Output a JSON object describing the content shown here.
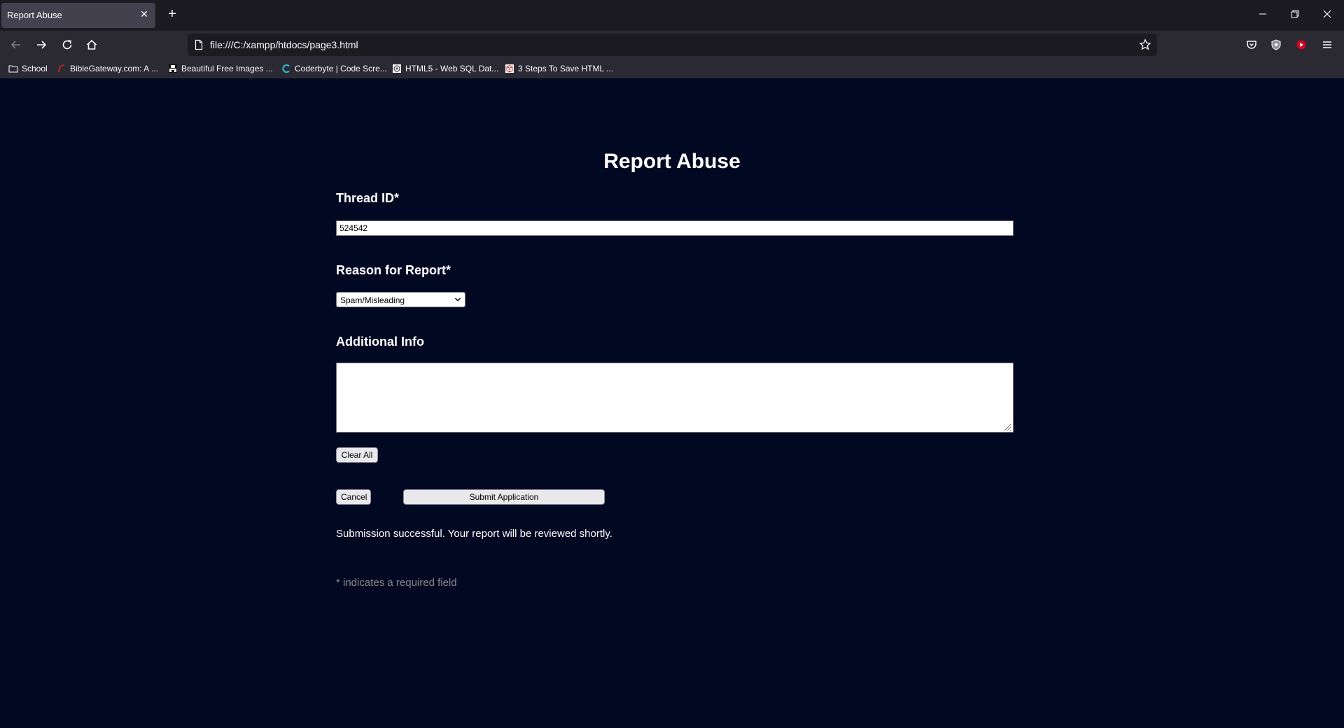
{
  "browser": {
    "tab_title": "Report Abuse",
    "url": "file:///C:/xampp/htdocs/page3.html",
    "bookmarks": [
      {
        "label": "School",
        "icon": "folder-icon"
      },
      {
        "label": "BibleGateway.com: A ...",
        "icon": "biblegateway-icon"
      },
      {
        "label": "Beautiful Free Images ...",
        "icon": "unsplash-icon"
      },
      {
        "label": "Coderbyte | Code Scre...",
        "icon": "coderbyte-icon"
      },
      {
        "label": "HTML5 - Web SQL Dat...",
        "icon": "tutorialspoint-icon"
      },
      {
        "label": "3 Steps To Save HTML ...",
        "icon": "package-icon"
      }
    ]
  },
  "form": {
    "title": "Report Abuse",
    "thread_label": "Thread ID*",
    "thread_value": "524542",
    "reason_label": "Reason for Report*",
    "reason_selected": "Spam/Misleading",
    "info_label": "Additional Info",
    "info_value": "",
    "clear_label": "Clear All",
    "cancel_label": "Cancel",
    "submit_label": "Submit Application",
    "success_message": "Submission successful. Your report will be reviewed shortly.",
    "required_note": "* indicates a required field"
  }
}
